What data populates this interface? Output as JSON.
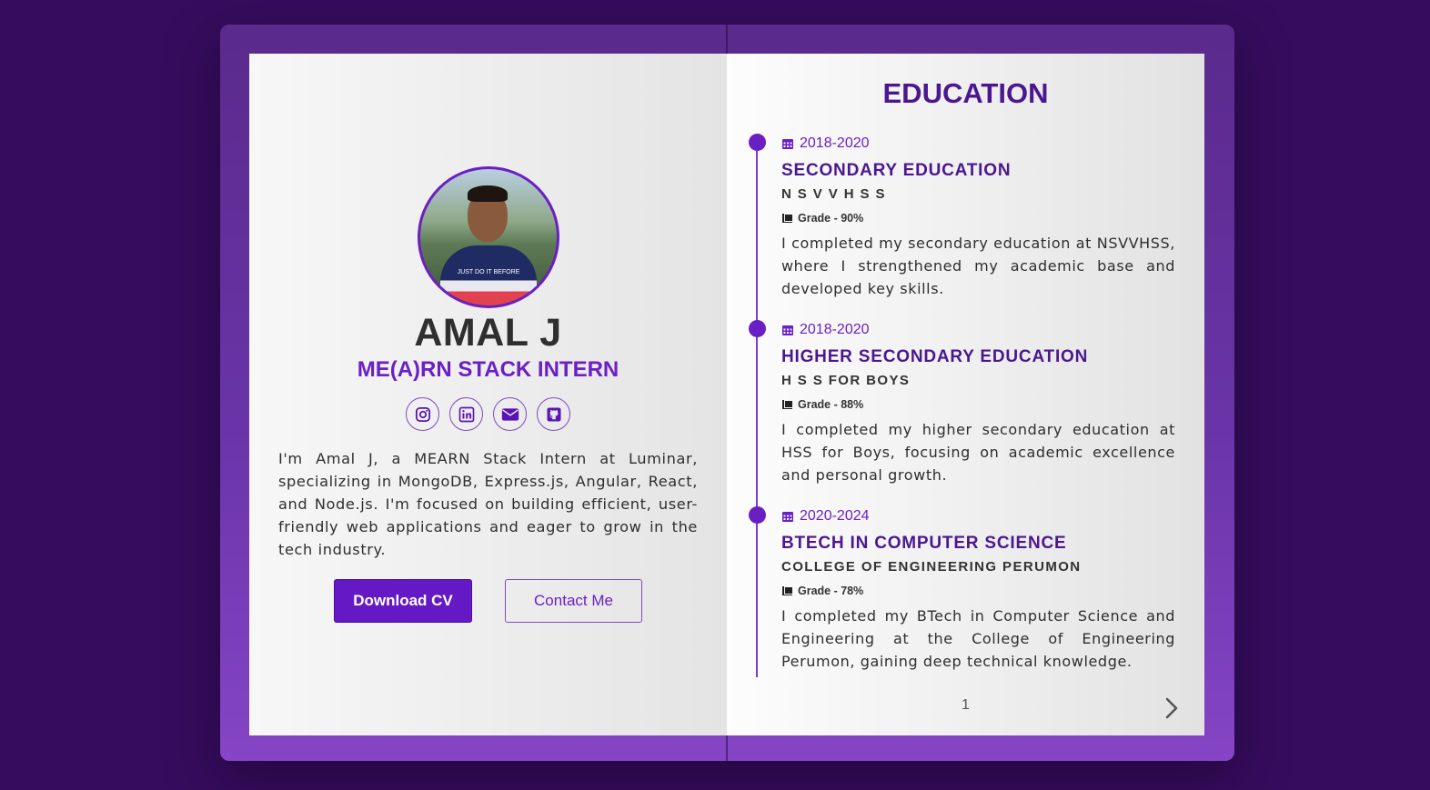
{
  "profile": {
    "name": "AMAL J",
    "role": "ME(A)RN STACK INTERN",
    "photo_text": "JUST DO IT BEFORE",
    "bio": "I'm Amal J, a MEARN Stack Intern at Luminar, specializing in MongoDB, Express.js, Angular, React, and Node.js. I'm focused on building efficient, user-friendly web applications and eager to grow in the tech industry.",
    "socials": [
      {
        "icon": "instagram-icon"
      },
      {
        "icon": "linkedin-icon"
      },
      {
        "icon": "envelope-icon"
      },
      {
        "icon": "github-icon"
      }
    ],
    "download_cv_label": "Download CV",
    "contact_label": "Contact Me"
  },
  "education": {
    "title": "EDUCATION",
    "entries": [
      {
        "date": "2018-2020",
        "degree": "SECONDARY EDUCATION",
        "school": "N S V V H S S",
        "grade": "Grade - 90%",
        "description": "I completed my secondary education at NSVVHSS, where I strengthened my academic base and developed key skills."
      },
      {
        "date": "2018-2020",
        "degree": "HIGHER SECONDARY EDUCATION",
        "school": "H S S FOR BOYS",
        "grade": "Grade - 88%",
        "description": "I completed my higher secondary education at HSS for Boys, focusing on academic excellence and personal growth."
      },
      {
        "date": "2020-2024",
        "degree": "BTECH IN COMPUTER SCIENCE",
        "school": "COLLEGE OF ENGINEERING PERUMON",
        "grade": "Grade - 78%",
        "description": "I completed my BTech in Computer Science and Engineering at the College of Engineering Perumon, gaining deep technical knowledge."
      }
    ]
  },
  "pagination": {
    "page_number": "1",
    "next_icon": "chevron-right-icon"
  },
  "colors": {
    "background": "#360c5e",
    "accent": "#6b1fc6",
    "heading": "#4a1791",
    "text": "#2e2e2e"
  }
}
